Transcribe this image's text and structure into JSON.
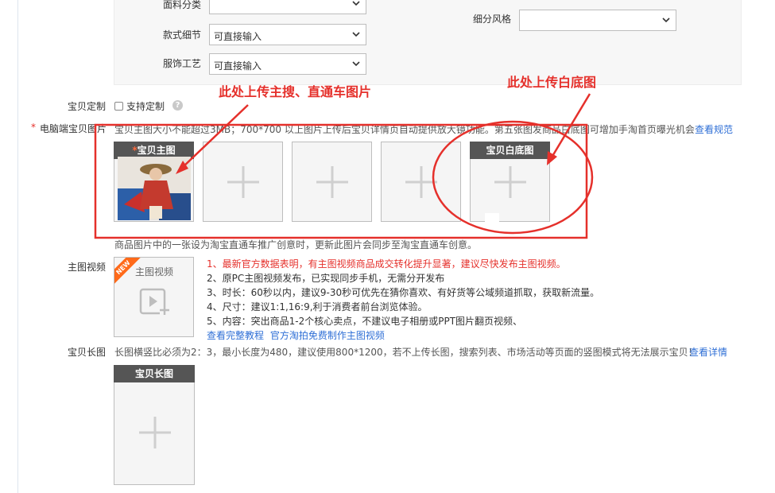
{
  "attrs": {
    "fabric_label": "面料分类",
    "style_detail_label": "款式细节",
    "style_detail_value": "可直接输入",
    "craft_label": "服饰工艺",
    "craft_value": "可直接输入",
    "sub_style_label": "细分风格"
  },
  "customize": {
    "label": "宝贝定制",
    "checkbox_label": "支持定制",
    "help_icon": "?"
  },
  "pc_images": {
    "required_mark": "*",
    "label": "电脑端宝贝图片",
    "tip": "宝贝主图大小不能超过3MB；700*700 以上图片上传后宝贝详情页自动提供放大镜功能。第五张图发商品白底图可增加手淘首页曝光机会",
    "rules_link": "查看规范",
    "main_tile_label": "宝贝主图",
    "main_tile_star": "*",
    "white_tile_label": "宝贝白底图",
    "footnote": "商品图片中的一张设为淘宝直通车推广创意时，更新此图片会同步至淘宝直通车创意。"
  },
  "annotations": {
    "left": "此处上传主搜、直通车图片",
    "right": "此处上传白底图"
  },
  "video": {
    "label": "主图视频",
    "tile_label": "主图视频",
    "new_badge": "NEW",
    "lines": [
      "1、最新官方数据表明，有主图视频商品成交转化提升显著，建议尽快发布主图视频。",
      "2、原PC主图视频发布，已实现同步手机，无需分开发布",
      "3、时长：60秒以内，建议9-30秒可优先在猜你喜欢、有好货等公域频道抓取，获取新流量。",
      "4、尺寸：建议1:1,16:9,利于消费者前台浏览体验。",
      "5、内容：突出商品1-2个核心卖点，不建议电子相册或PPT图片翻页视频、"
    ],
    "link1": "查看完整教程",
    "link2": "官方淘拍免费制作主图视频"
  },
  "long_image": {
    "label": "宝贝长图",
    "tip": "长图横竖比必须为2：3，最小长度为480，建议使用800*1200，若不上传长图，搜索列表、市场活动等页面的竖图模式将无法展示宝贝！",
    "detail_link": "查看详情",
    "tile_label": "宝贝长图"
  },
  "colors": {
    "annotation_red": "#e5302b",
    "link_blue": "#2f6fd6",
    "tile_header": "#555555"
  }
}
